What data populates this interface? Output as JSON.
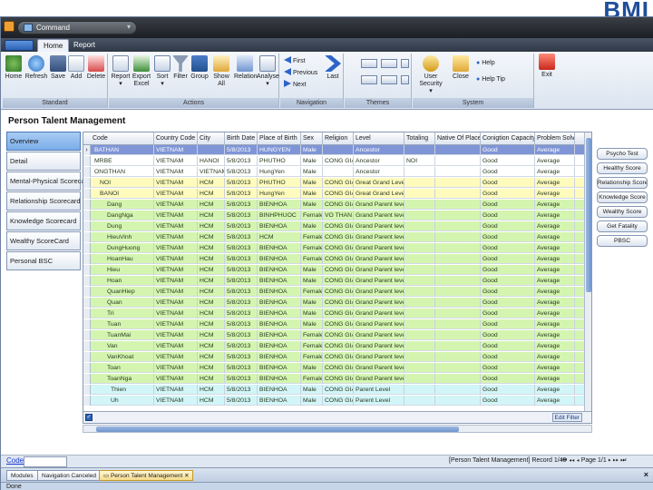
{
  "brand": "BMI",
  "window": {
    "qat_title": "Command"
  },
  "ribbon": {
    "file_label": "",
    "tabs": [
      "Home",
      "Report"
    ],
    "buttons": {
      "home": "Home",
      "refresh": "Refresh",
      "save": "Save",
      "add": "Add",
      "delete": "Delete",
      "report": "Report",
      "export": "Export",
      "export2": "Excel",
      "sort": "Sort",
      "filter": "Filter",
      "group": "Group",
      "showall": "Show All",
      "relation": "Relation",
      "analyse": "Analyse",
      "first": "First",
      "previous": "Previous",
      "next": "Next",
      "last": "Last",
      "usersecurity": "User Security",
      "close": "Close",
      "help": "Help",
      "helptip": "Help Tip",
      "exit": "Exit"
    },
    "groups": {
      "standard": "Standard",
      "actions": "Actions",
      "navigation": "Navigation",
      "themes": "Themes",
      "system": "System"
    }
  },
  "page": {
    "title": "Person Talent Management"
  },
  "left_nav": [
    "Overview",
    "Detail",
    "Mental-Physical Scorecard",
    "Relationship Scorecard",
    "Knowledge Scorecard",
    "Wealthy ScoreCard",
    "Personal BSC"
  ],
  "grid": {
    "columns": [
      "Code",
      "Country Code",
      "City",
      "Birth Date",
      "Place of Birth",
      "Sex",
      "Religion",
      "Level",
      "Totaling",
      "Native Of Place",
      "Conigtion Capacity",
      "Problem Solve"
    ],
    "colors": {
      "blue": "#7f95d6",
      "white": "#ffffff",
      "yellow": "#fffbbd",
      "green": "#d4f5b0",
      "cyan": "#d2f5f8",
      "selected_text": "#ffffff"
    },
    "rows": [
      {
        "indicator": "›",
        "tint": "blue",
        "cells": [
          "BATHAN",
          "VIETNAM",
          "",
          "5/8/2013",
          "HUNGYEN",
          "Male",
          "",
          "Ancestor",
          "",
          "",
          "Good",
          "Average"
        ]
      },
      {
        "indicator": "",
        "tint": "white",
        "cells": [
          "MRBE",
          "VIETNAM",
          "HANOI",
          "5/8/2013",
          "PHUTHO",
          "Male",
          "CONG GIAO",
          "Ancestor",
          "NOI",
          "",
          "Good",
          "Average"
        ]
      },
      {
        "indicator": "",
        "tint": "white",
        "cells": [
          "ONGTHAN",
          "VIETNAM",
          "VIETNAM",
          "5/8/2013",
          "HungYen",
          "Male",
          "",
          "Ancestor",
          "",
          "",
          "Good",
          "Average"
        ]
      },
      {
        "indicator": "",
        "tint": "yellow",
        "cells": [
          "NOI",
          "VIETNAM",
          "HCM",
          "5/8/2013",
          "PHUTHO",
          "Male",
          "CONG GIAO",
          "Great Grand Level",
          "",
          "",
          "Good",
          "Average"
        ]
      },
      {
        "indicator": "",
        "tint": "yellow",
        "cells": [
          "BANOI",
          "VIETNAM",
          "HCM",
          "5/8/2013",
          "HungYen",
          "Male",
          "CONG GIAO",
          "Great Grand Level",
          "",
          "",
          "Good",
          "Average"
        ]
      },
      {
        "indicator": "",
        "tint": "green",
        "cells": [
          "Dang",
          "VIETNAM",
          "HCM",
          "5/8/2013",
          "BIENHOA",
          "Male",
          "CONG GIAO",
          "Grand Parent level",
          "",
          "",
          "Good",
          "Average"
        ]
      },
      {
        "indicator": "",
        "tint": "green",
        "cells": [
          "DangNga",
          "VIETNAM",
          "HCM",
          "5/8/2013",
          "BINHPHUOC",
          "Female",
          "VO THAN",
          "Grand Parent level",
          "",
          "",
          "Good",
          "Average"
        ]
      },
      {
        "indicator": "",
        "tint": "green",
        "cells": [
          "Dung",
          "VIETNAM",
          "HCM",
          "5/8/2013",
          "BIENHOA",
          "Male",
          "CONG GIAO",
          "Grand Parent level",
          "",
          "",
          "Good",
          "Average"
        ]
      },
      {
        "indicator": "",
        "tint": "green",
        "cells": [
          "HieuVinh",
          "VIETNAM",
          "HCM",
          "5/8/2013",
          "HCM",
          "Female",
          "CONG GIAO",
          "Grand Parent level",
          "",
          "",
          "Good",
          "Average"
        ]
      },
      {
        "indicator": "",
        "tint": "green",
        "cells": [
          "DungHuong",
          "VIETNAM",
          "HCM",
          "5/8/2013",
          "BIENHOA",
          "Female",
          "CONG GIAO",
          "Grand Parent level",
          "",
          "",
          "Good",
          "Average"
        ]
      },
      {
        "indicator": "",
        "tint": "green",
        "cells": [
          "HoanHau",
          "VIETNAM",
          "HCM",
          "5/8/2013",
          "BIENHOA",
          "Female",
          "CONG GIAO",
          "Grand Parent level",
          "",
          "",
          "Good",
          "Average"
        ]
      },
      {
        "indicator": "",
        "tint": "green",
        "cells": [
          "Hieu",
          "VIETNAM",
          "HCM",
          "5/8/2013",
          "BIENHOA",
          "Male",
          "CONG GIAO",
          "Grand Parent level",
          "",
          "",
          "Good",
          "Average"
        ]
      },
      {
        "indicator": "",
        "tint": "green",
        "cells": [
          "Hoan",
          "VIETNAM",
          "HCM",
          "5/8/2013",
          "BIENHOA",
          "Male",
          "CONG GIAO",
          "Grand Parent level",
          "",
          "",
          "Good",
          "Average"
        ]
      },
      {
        "indicator": "",
        "tint": "green",
        "cells": [
          "QuanHiep",
          "VIETNAM",
          "HCM",
          "5/8/2013",
          "BIENHOA",
          "Female",
          "CONG GIAO",
          "Grand Parent level",
          "",
          "",
          "Good",
          "Average"
        ]
      },
      {
        "indicator": "",
        "tint": "green",
        "cells": [
          "Quan",
          "VIETNAM",
          "HCM",
          "5/8/2013",
          "BIENHOA",
          "Male",
          "CONG GIAO",
          "Grand Parent level",
          "",
          "",
          "Good",
          "Average"
        ]
      },
      {
        "indicator": "",
        "tint": "green",
        "cells": [
          "Tri",
          "VIETNAM",
          "HCM",
          "5/8/2013",
          "BIENHOA",
          "Male",
          "CONG GIAO",
          "Grand Parent level",
          "",
          "",
          "Good",
          "Average"
        ]
      },
      {
        "indicator": "",
        "tint": "green",
        "cells": [
          "Tuan",
          "VIETNAM",
          "HCM",
          "5/8/2013",
          "BIENHOA",
          "Male",
          "CONG GIAO",
          "Grand Parent level",
          "",
          "",
          "Good",
          "Average"
        ]
      },
      {
        "indicator": "",
        "tint": "green",
        "cells": [
          "TuanMai",
          "VIETNAM",
          "HCM",
          "5/8/2013",
          "BIENHOA",
          "Female",
          "CONG GIAO",
          "Grand Parent level",
          "",
          "",
          "Good",
          "Average"
        ]
      },
      {
        "indicator": "",
        "tint": "green",
        "cells": [
          "Van",
          "VIETNAM",
          "HCM",
          "5/8/2013",
          "BIENHOA",
          "Female",
          "CONG GIAO",
          "Grand Parent level",
          "",
          "",
          "Good",
          "Average"
        ]
      },
      {
        "indicator": "",
        "tint": "green",
        "cells": [
          "VanKhoat",
          "VIETNAM",
          "HCM",
          "5/8/2013",
          "BIENHOA",
          "Female",
          "CONG GIAO",
          "Grand Parent level",
          "",
          "",
          "Good",
          "Average"
        ]
      },
      {
        "indicator": "",
        "tint": "green",
        "cells": [
          "Toan",
          "VIETNAM",
          "HCM",
          "5/8/2013",
          "BIENHOA",
          "Male",
          "CONG GIAO",
          "Grand Parent level",
          "",
          "",
          "Good",
          "Average"
        ]
      },
      {
        "indicator": "",
        "tint": "green",
        "cells": [
          "ToanNga",
          "VIETNAM",
          "HCM",
          "5/8/2013",
          "BIENHOA",
          "Female",
          "CONG GIAO",
          "Grand Parent level",
          "",
          "",
          "Good",
          "Average"
        ]
      },
      {
        "indicator": "",
        "tint": "cyan",
        "cells": [
          "Thien",
          "VIETNAM",
          "HCM",
          "5/8/2013",
          "BIENHOA",
          "Male",
          "CONG GIAO",
          "Parent Level",
          "",
          "",
          "Good",
          "Average"
        ]
      },
      {
        "indicator": "",
        "tint": "cyan",
        "cells": [
          "Uh",
          "VIETNAM",
          "HCM",
          "5/8/2013",
          "BIENHOA",
          "Male",
          "CONG GIAO",
          "Parent Level",
          "",
          "",
          "Good",
          "Average"
        ]
      }
    ],
    "edit_filter": "Edit Filter"
  },
  "right_panel": [
    "Psycho Test",
    "Healthy Score",
    "Relationship Score",
    "Knowledge Score",
    "Wealthy Score",
    "Get Fatality",
    "PBSC"
  ],
  "status": {
    "code_label": "Code",
    "record": "[Person Talent Management] Record 1/40",
    "page": "Page 1/1"
  },
  "bottom_tabs": [
    "Modules",
    "Navigation Canceled",
    "Person Talent Management"
  ],
  "statusbar": {
    "text": "Done"
  }
}
